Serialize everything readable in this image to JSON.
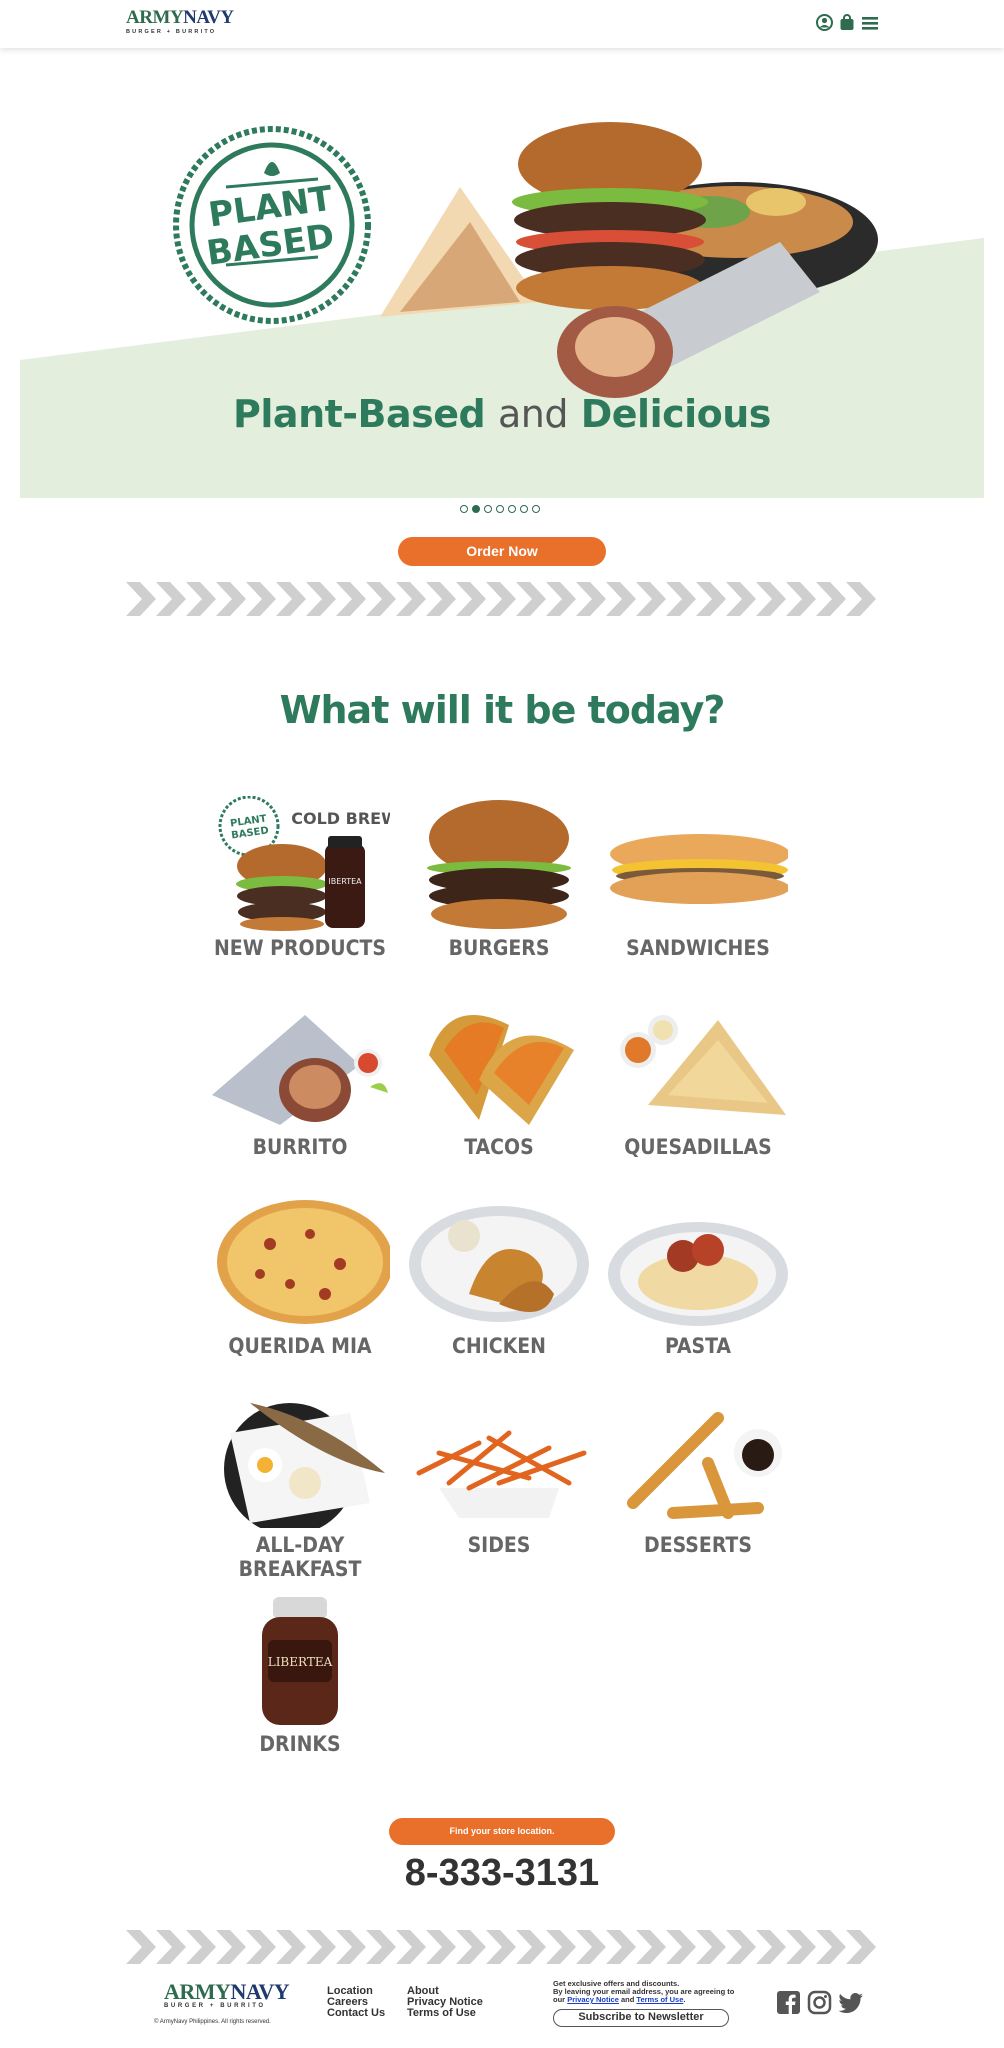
{
  "header": {
    "logo_brand_army": "ARMY",
    "logo_brand_navy": "NAVY",
    "logo_sub": "BURGER + BURRITO",
    "icons": [
      "user-icon",
      "shopping-bag-icon",
      "menu-icon"
    ]
  },
  "hero": {
    "badge_line1": "PLANT",
    "badge_line2": "BASED",
    "title_part1": "Plant-Based",
    "title_and": "and",
    "title_part2": "Delicious",
    "slide_count": 7,
    "active_slide": 2
  },
  "order_button": "Order Now",
  "section_title": "What will it be today?",
  "categories": [
    {
      "label": "NEW PRODUCTS",
      "badge": "PLANT BASED",
      "extra": "COLD BREW",
      "jar_text": "IBERTEA"
    },
    {
      "label": "BURGERS"
    },
    {
      "label": "SANDWICHES"
    },
    {
      "label": "BURRITO"
    },
    {
      "label": "TACOS"
    },
    {
      "label": "QUESADILLAS"
    },
    {
      "label": "QUERIDA MIA"
    },
    {
      "label": "CHICKEN"
    },
    {
      "label": "PASTA"
    },
    {
      "label": "ALL-DAY BREAKFAST"
    },
    {
      "label": "SIDES"
    },
    {
      "label": "DESSERTS"
    },
    {
      "label": "DRINKS",
      "jar_text": "LIBERTEA"
    }
  ],
  "store_button": "Find your store location.",
  "phone": "8-333-3131",
  "footer": {
    "copyright": "© ArmyNavy Philippines. All rights reserved.",
    "links_col1": [
      "Location",
      "Careers",
      "Contact Us"
    ],
    "links_col2": [
      "About",
      "Privacy Notice",
      "Terms of Use"
    ],
    "newsletter_line1": "Get exclusive offers and discounts.",
    "newsletter_line2": "By leaving your email address, you are agreeing to",
    "newsletter_our": "our",
    "privacy_link": "Privacy Notice",
    "and": "and",
    "terms_link": "Terms of Use",
    "subscribe_button": "Subscribe to Newsletter",
    "social_icons": [
      "facebook-icon",
      "instagram-icon",
      "twitter-icon"
    ]
  },
  "colors": {
    "brand_green": "#2e7a5c",
    "brand_navy": "#1f3a6e",
    "accent_orange": "#e8702a",
    "hero_band": "#e3efdc",
    "chevron_gray": "#cfcfcf"
  }
}
